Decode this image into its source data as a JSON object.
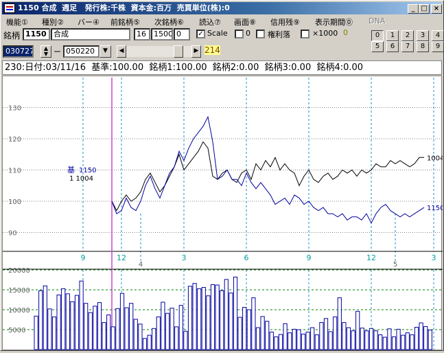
{
  "window": {
    "title": "1150 合成  週足   発行株:千株  資本金:百万  売買単位(株):0",
    "minimize_label": "_",
    "maximize_label": "□",
    "close_label": "×"
  },
  "menu": [
    {
      "label": "機能①",
      "disabled": false
    },
    {
      "label": "種別②",
      "disabled": false
    },
    {
      "label": "バー④",
      "disabled": false
    },
    {
      "label": "前銘柄⑤",
      "disabled": false
    },
    {
      "label": "次銘柄⑥",
      "disabled": false
    },
    {
      "label": "読込⑦",
      "disabled": false
    },
    {
      "label": "画面⑧",
      "disabled": false
    },
    {
      "label": "信用残⑨",
      "disabled": false
    },
    {
      "label": "表示期間⓪",
      "disabled": false
    },
    {
      "label": "DNA",
      "disabled": true
    }
  ],
  "controls": {
    "code_label": "銘柄",
    "code_value": "1150",
    "name_value": "合成",
    "param1": "16",
    "param2": "1500",
    "param3": "0",
    "scale_label": "Scale",
    "scale_checked": true,
    "zero_label": "0",
    "kenri_label": "権利落",
    "x1000_label": "×1000",
    "x1000_value": "0",
    "number_buttons_row1": [
      "0",
      "1",
      "2",
      "3",
      "4"
    ],
    "number_buttons_row2": [
      "5",
      "6",
      "7",
      "8",
      "9"
    ],
    "start_date": "030727",
    "separator": "ー",
    "end_date": "050220",
    "slider_value": "214"
  },
  "info": {
    "text": "230:日付:03/11/16  基準:100.00  銘柄1:100.00  銘柄2:0.00  銘柄3:0.00  銘柄4:0.00"
  },
  "chart_data": [
    {
      "type": "line",
      "y_ticks": [
        "130",
        "120",
        "110",
        "100",
        "90"
      ],
      "ylim": [
        80,
        140
      ],
      "x_labels": [
        {
          "label": "9",
          "i": -6
        },
        {
          "label": "12",
          "i": 2
        },
        {
          "label": "3",
          "i": 15
        },
        {
          "label": "6",
          "i": 28
        },
        {
          "label": "9",
          "i": 41
        },
        {
          "label": "12",
          "i": 54
        },
        {
          "label": "3",
          "i": 67
        }
      ],
      "x_sublabels": [
        {
          "label": "4",
          "i": 6
        },
        {
          "label": "5",
          "i": 59
        }
      ],
      "legend_marker": "基",
      "legend": [
        {
          "label": "1150",
          "color": "#0000a0"
        },
        {
          "label": "1   1004",
          "color": "#000000"
        }
      ],
      "series": [
        {
          "name": "1004",
          "color": "#000000",
          "values": [
            100,
            97,
            100,
            102,
            100,
            101,
            103,
            107,
            109,
            106,
            103,
            105,
            108,
            111,
            115,
            110,
            112,
            114,
            116,
            119,
            117,
            108,
            107,
            109,
            110,
            107,
            106,
            109,
            110,
            107,
            112,
            110,
            113,
            111,
            114,
            110,
            112,
            110,
            109,
            105,
            108,
            110,
            107,
            106,
            108,
            109,
            107,
            108,
            110,
            109,
            110,
            108,
            110,
            109,
            110,
            112,
            111,
            111,
            113,
            112,
            113,
            112,
            111,
            112,
            114,
            114
          ]
        },
        {
          "name": "1150",
          "color": "#0000a0",
          "values": [
            100,
            96,
            97,
            101,
            98,
            97,
            100,
            105,
            108,
            104,
            101,
            105,
            109,
            111,
            116,
            113,
            117,
            120,
            122,
            124,
            127,
            119,
            107,
            108,
            110,
            107,
            107,
            105,
            109,
            106,
            104,
            106,
            104,
            102,
            99,
            100,
            101,
            99,
            102,
            101,
            99,
            100,
            98,
            97,
            98,
            96,
            96,
            95,
            96,
            94,
            95,
            95,
            94,
            96,
            93,
            96,
            98,
            99,
            97,
            96,
            95,
            96,
            95,
            96,
            97,
            98
          ]
        }
      ]
    },
    {
      "type": "bar",
      "y_ticks": [
        "20000",
        "15000",
        "10000",
        "5000"
      ],
      "ylim": [
        0,
        20000
      ],
      "values": [
        8400,
        14800,
        16000,
        10200,
        8200,
        13700,
        15300,
        14000,
        12000,
        13600,
        17200,
        11600,
        9300,
        10900,
        11800,
        6800,
        8700,
        5700,
        10300,
        14100,
        10500,
        11600,
        7600,
        6400,
        2800,
        3600,
        5300,
        8200,
        11900,
        9100,
        10400,
        5700,
        11100,
        4600,
        15900,
        16600,
        15300,
        15600,
        13500,
        16300,
        16200,
        14800,
        17600,
        14200,
        18200,
        8100,
        10600,
        10000,
        13000,
        5500,
        8300,
        7100,
        4400,
        3200,
        3800,
        6500,
        4200,
        5100,
        5000,
        3900,
        4400,
        5500,
        3700,
        6800,
        7800,
        4500,
        8200,
        13000,
        6800,
        5500,
        4700,
        9600,
        5400,
        4700,
        5300,
        4700,
        3700,
        3100,
        5200,
        3200,
        5100,
        3600,
        4200,
        3700,
        5600,
        6700,
        5800,
        4900
      ],
      "series": [
        {
          "color": "#0000a0"
        }
      ]
    }
  ]
}
